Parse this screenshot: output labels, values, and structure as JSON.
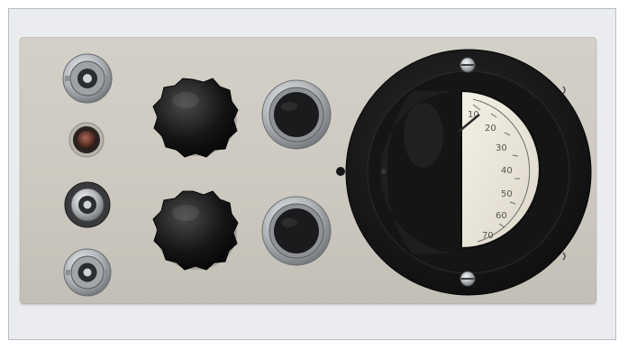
{
  "image": {
    "subject": "front-panel",
    "colors": {
      "frame_bg": "#eaecef",
      "panel": "#cfcbc3",
      "knob": "#141414",
      "meter_ring": "#1a1a1a",
      "meter_face": "#ece8dc",
      "chrome": "#b9bcc0"
    }
  },
  "meter": {
    "scale_labels": [
      "10",
      "20",
      "30",
      "40",
      "50",
      "60",
      "70"
    ]
  },
  "components": {
    "connectors": [
      "bnc-connector",
      "indicator-lamp",
      "bnc-connector",
      "bnc-connector"
    ],
    "knobs": [
      "knob",
      "knob"
    ],
    "switches": [
      "push-switch",
      "push-switch"
    ]
  }
}
